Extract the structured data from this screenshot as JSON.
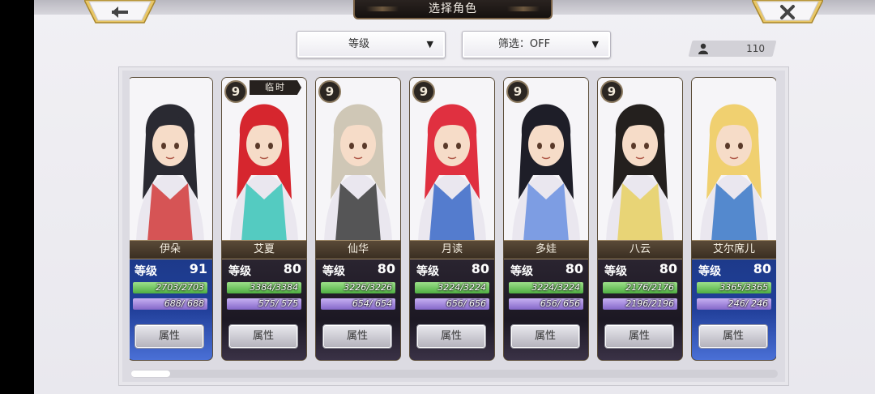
{
  "header": {
    "title": "选择角色",
    "back_icon": "back-arrow-icon",
    "close_icon": "close-x-icon"
  },
  "filters": {
    "sort_label": "等级",
    "filter_label": "筛选：OFF",
    "dropdown_arrow": "▼"
  },
  "roster": {
    "count": "110",
    "count_icon": "person-icon"
  },
  "stat_label": "等级",
  "attr_label": "属性",
  "cards": [
    {
      "name": "伊朵",
      "rank": "",
      "tag": "",
      "level": "91",
      "hp": "2703/2703",
      "hp_frac": 1.0,
      "mp": "688/ 688",
      "mp_frac": 1.0,
      "style": "blue",
      "hair": "#2a2a32",
      "accent": "#d23a3a"
    },
    {
      "name": "艾夏",
      "rank": "9",
      "tag": "临时",
      "level": "80",
      "hp": "3384/3384",
      "hp_frac": 1.0,
      "mp": "575/ 575",
      "mp_frac": 1.0,
      "style": "dark",
      "hair": "#d6262e",
      "accent": "#39c6b8"
    },
    {
      "name": "仙华",
      "rank": "9",
      "tag": "",
      "level": "80",
      "hp": "3226/3226",
      "hp_frac": 1.0,
      "mp": "654/ 654",
      "mp_frac": 1.0,
      "style": "dark",
      "hair": "#cfc7b6",
      "accent": "#3b3b3b"
    },
    {
      "name": "月读",
      "rank": "9",
      "tag": "",
      "level": "80",
      "hp": "3224/3224",
      "hp_frac": 1.0,
      "mp": "656/ 656",
      "mp_frac": 1.0,
      "style": "dark",
      "hair": "#e03040",
      "accent": "#3a68c8"
    },
    {
      "name": "多娃",
      "rank": "9",
      "tag": "",
      "level": "80",
      "hp": "3224/3224",
      "hp_frac": 1.0,
      "mp": "656/ 656",
      "mp_frac": 1.0,
      "style": "dark",
      "hair": "#1e1e28",
      "accent": "#6a8fe0"
    },
    {
      "name": "八云",
      "rank": "9",
      "tag": "",
      "level": "80",
      "hp": "2176/2176",
      "hp_frac": 1.0,
      "mp": "2196/2196",
      "mp_frac": 1.0,
      "style": "dark",
      "hair": "#24201e",
      "accent": "#e8d060"
    },
    {
      "name": "艾尔席儿",
      "rank": "",
      "tag": "",
      "level": "80",
      "hp": "3365/3365",
      "hp_frac": 1.0,
      "mp": "246/ 246",
      "mp_frac": 1.0,
      "style": "blue",
      "hair": "#f0d070",
      "accent": "#3a78c8"
    }
  ]
}
